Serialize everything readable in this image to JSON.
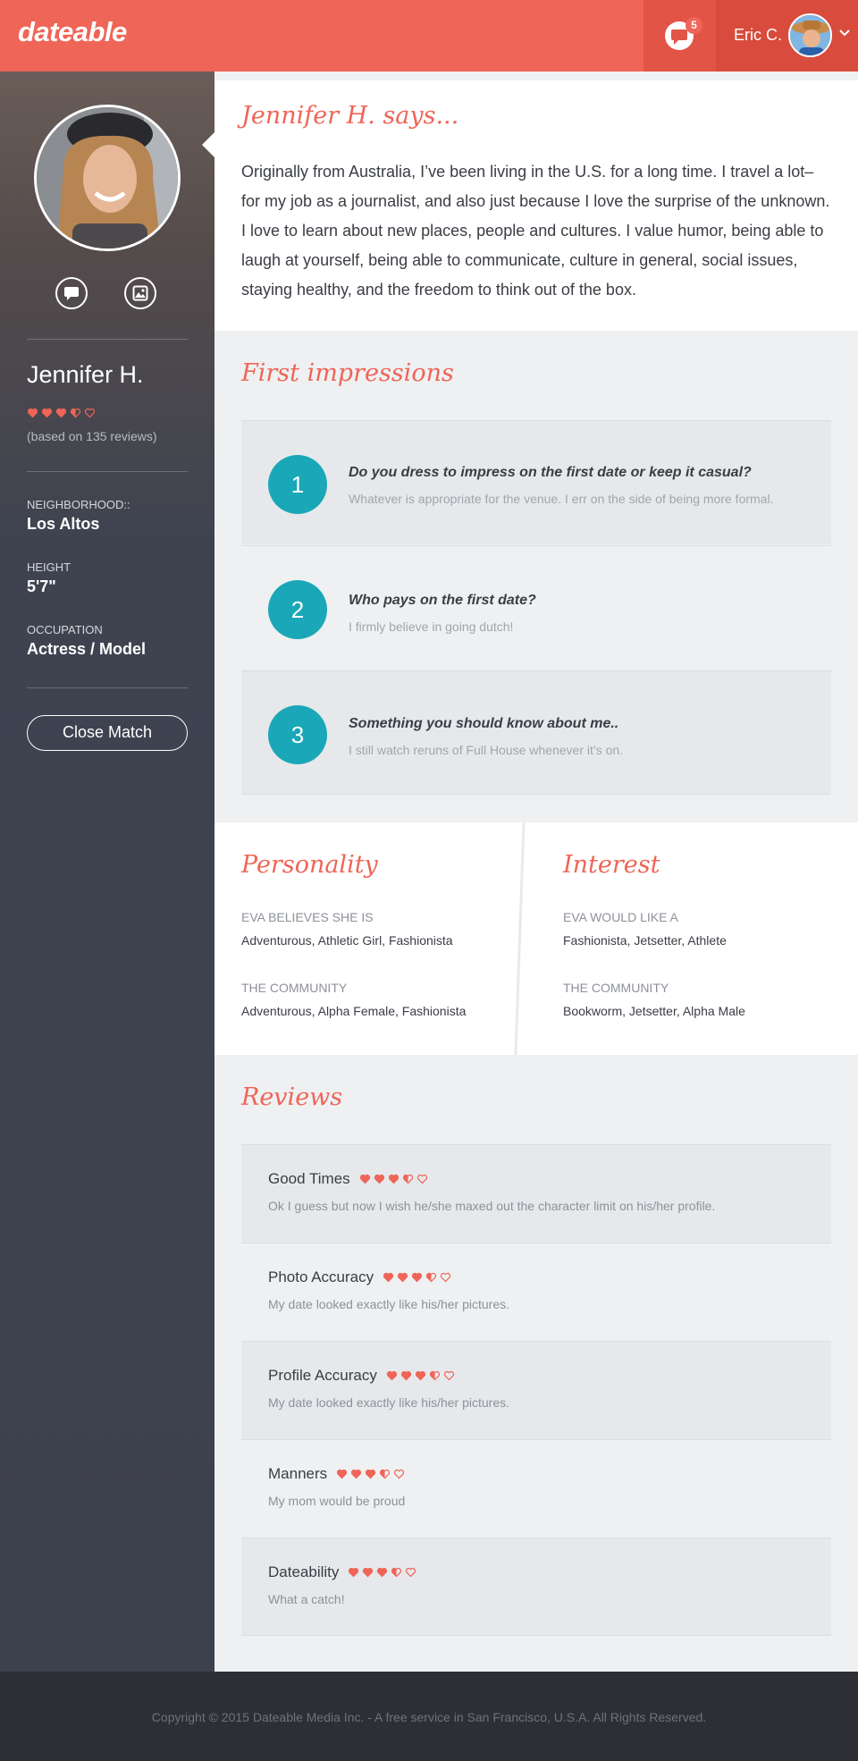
{
  "header": {
    "logo": "dateable",
    "message_count": "5",
    "user_name": "Eric C.",
    "accent_color": "#ef6557"
  },
  "profile": {
    "name": "Jennifer H.",
    "rating": 3.5,
    "rating_max": 5,
    "reviews_text": "(based on 135 reviews)",
    "neighborhood_label": "NEIGHBORHOOD::",
    "neighborhood": "Los Altos",
    "height_label": "HEIGHT",
    "height": "5'7\"",
    "occupation_label": "OCCUPATION",
    "occupation": "Actress / Model",
    "close_match_label": "Close Match"
  },
  "about": {
    "title": "Jennifer H. says...",
    "text": "Originally from Australia, I’ve been living in the U.S. for a long time. I travel a lot–for my job as a journalist, and also just because I love the surprise of the unknown. I love to learn about new places, people and cultures. I value humor, being able to laugh at yourself, being able to communicate, culture in general, social issues, staying healthy, and the freedom to think out of the box."
  },
  "impressions": {
    "title": "First impressions",
    "items": [
      {
        "number": "1",
        "question": "Do you dress to impress on the first date or keep it casual?",
        "answer": "Whatever is appropriate for the venue. I err on the side of being more formal."
      },
      {
        "number": "2",
        "question": "Who pays on the first date?",
        "answer": "I firmly believe in going dutch!"
      },
      {
        "number": "3",
        "question": "Something you should know about me..",
        "answer": "I still watch reruns of Full House whenever it’s on."
      }
    ]
  },
  "personality": {
    "title": "Personality",
    "self_label": "EVA BELIEVES SHE IS",
    "self_value": "Adventurous, Athletic Girl, Fashionista",
    "community_label": "THE COMMUNITY",
    "community_value": "Adventurous, Alpha Female, Fashionista"
  },
  "interest": {
    "title": "Interest",
    "self_label": "EVA WOULD LIKE A",
    "self_value": "Fashionista, Jetsetter, Athlete",
    "community_label": "THE COMMUNITY",
    "community_value": "Bookworm, Jetsetter, Alpha Male"
  },
  "reviews": {
    "title": "Reviews",
    "items": [
      {
        "title": "Good Times",
        "rating": 3.5,
        "text": "Ok I guess but now I wish he/she maxed out the character limit on his/her profile."
      },
      {
        "title": "Photo Accuracy",
        "rating": 3.5,
        "text": "My date looked exactly like his/her pictures."
      },
      {
        "title": "Profile Accuracy",
        "rating": 3.5,
        "text": "My date looked exactly like his/her pictures."
      },
      {
        "title": "Manners",
        "rating": 3.5,
        "text": "My mom would be proud"
      },
      {
        "title": "Dateability",
        "rating": 3.5,
        "text": "What a catch!"
      }
    ]
  },
  "footer": {
    "text": "Copyright © 2015 Dateable Media Inc. - A free service in San Francisco, U.S.A. All Rights Reserved."
  }
}
